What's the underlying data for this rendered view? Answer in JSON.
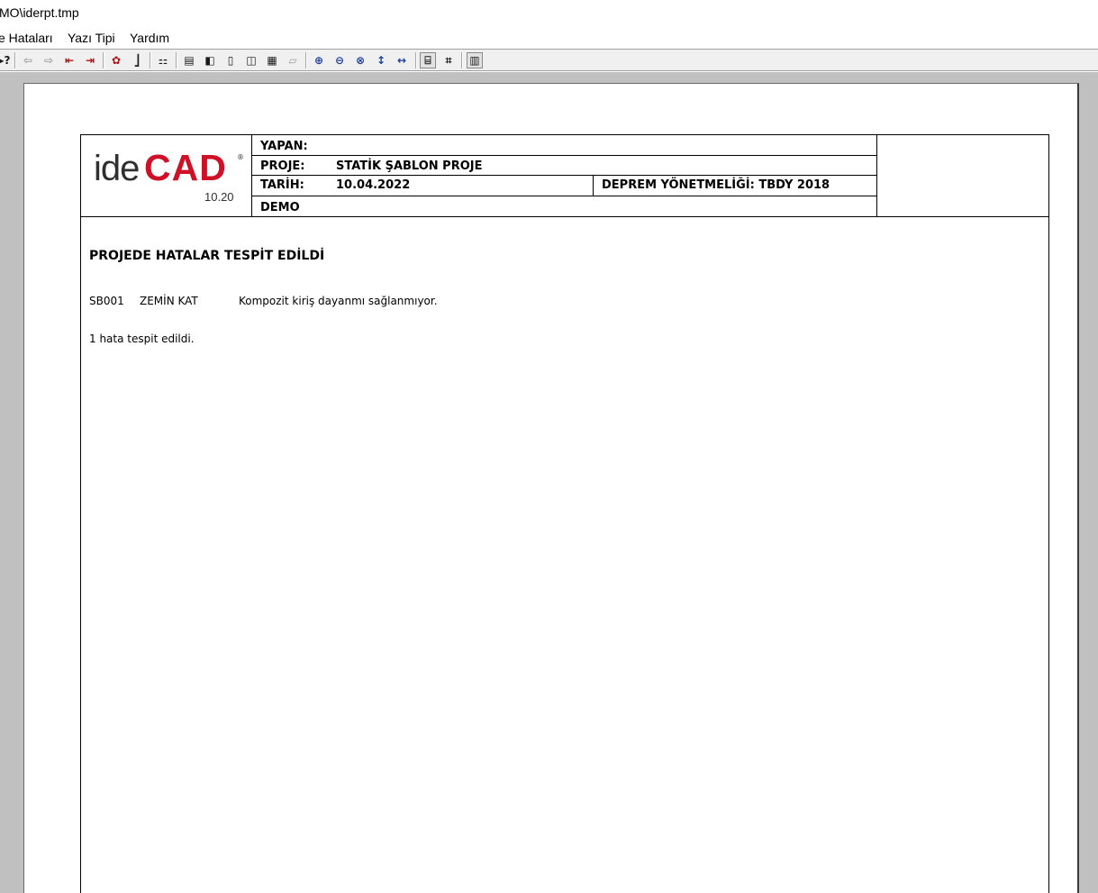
{
  "window": {
    "title": "MO\\iderpt.tmp"
  },
  "menu": {
    "items": [
      "e Hataları",
      "Yazı Tipi",
      "Yardım"
    ]
  },
  "toolbar": {
    "buttons": [
      {
        "name": "help-icon",
        "glyph": "▸?"
      },
      {
        "name": "back-arrow-icon",
        "glyph": "⇦"
      },
      {
        "name": "forward-arrow-icon",
        "glyph": "⇨"
      },
      {
        "name": "first-page-icon",
        "glyph": "⇤"
      },
      {
        "name": "last-page-icon",
        "glyph": "⇥"
      },
      {
        "name": "settings-icon",
        "glyph": "✿"
      },
      {
        "name": "insert-icon",
        "glyph": "⎦"
      },
      {
        "name": "tree-icon",
        "glyph": "⚏"
      },
      {
        "name": "page-view-1-icon",
        "glyph": "▤"
      },
      {
        "name": "page-view-2-icon",
        "glyph": "◧"
      },
      {
        "name": "page-view-3-icon",
        "glyph": "▯"
      },
      {
        "name": "page-view-4-icon",
        "glyph": "◫"
      },
      {
        "name": "table-icon",
        "glyph": "▦"
      },
      {
        "name": "disabled-view-icon",
        "glyph": "▱"
      },
      {
        "name": "zoom-in-icon",
        "glyph": "⊕"
      },
      {
        "name": "zoom-out-icon",
        "glyph": "⊖"
      },
      {
        "name": "zoom-fit-icon",
        "glyph": "⊗"
      },
      {
        "name": "fit-height-icon",
        "glyph": "↕"
      },
      {
        "name": "fit-width-icon",
        "glyph": "↔"
      },
      {
        "name": "single-page-icon",
        "glyph": "⌸"
      },
      {
        "name": "multi-page-icon",
        "glyph": "⌗"
      },
      {
        "name": "report-icon",
        "glyph": "▥"
      }
    ]
  },
  "report": {
    "logo": {
      "ide": "ide",
      "cad": "CAD",
      "reg": "®",
      "version": "10.20"
    },
    "header": {
      "yapan_label": "YAPAN:",
      "yapan_value": "",
      "proje_label": "PROJE:",
      "proje_value": "STATİK ŞABLON PROJE",
      "tarih_label": "TARİH:",
      "tarih_value": "10.04.2022",
      "deprem": "DEPREM YÖNETMELİĞİ: TBDY 2018",
      "demo": "DEMO"
    },
    "title": "PROJEDE HATALAR TESPİT EDİLDİ",
    "errors": [
      {
        "code": "SB001",
        "floor": "ZEMİN KAT",
        "message": "Kompozit kiriş dayanmı sağlanmıyor."
      }
    ],
    "summary": "1 hata tespit edildi."
  }
}
